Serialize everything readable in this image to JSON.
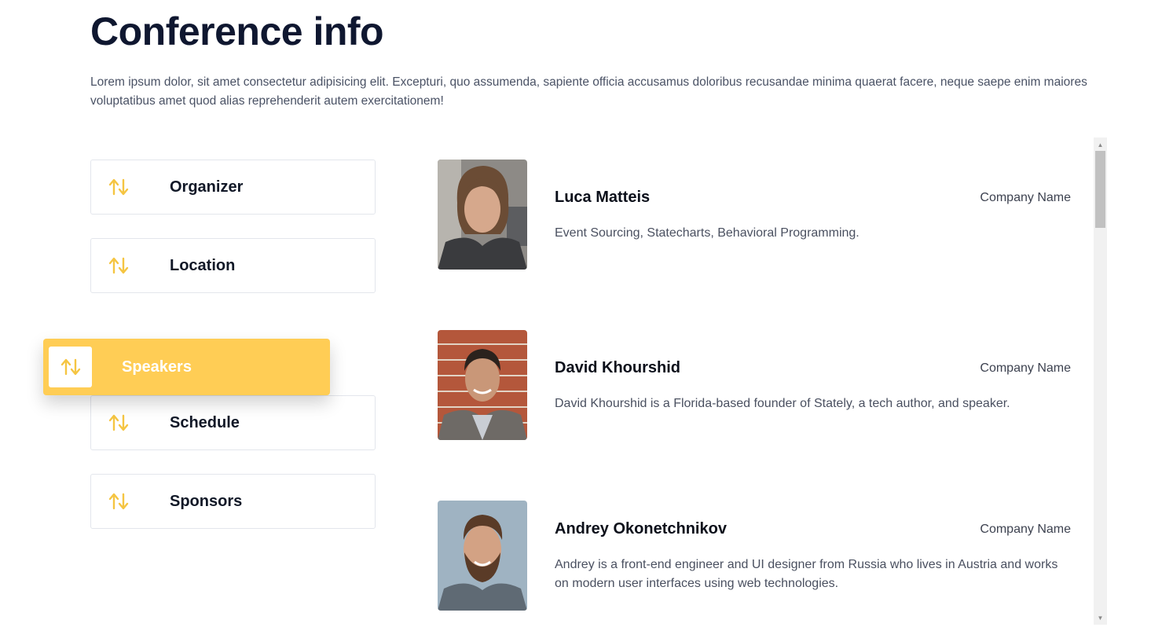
{
  "page": {
    "title": "Conference info",
    "intro": "Lorem ipsum dolor, sit amet consectetur adipisicing elit. Excepturi, quo assumenda, sapiente officia accusamus doloribus recusandae minima quaerat facere, neque saepe enim maiores voluptatibus amet quod alias reprehenderit autem exercitationem!"
  },
  "nav": {
    "icon": "sort-arrows-icon",
    "accent_color": "#ffcd55",
    "items": [
      {
        "label": "Organizer"
      },
      {
        "label": "Location"
      },
      {
        "label": "Schedule"
      },
      {
        "label": "Sponsors"
      }
    ],
    "dragging": {
      "label": "Speakers"
    }
  },
  "speakers": [
    {
      "name": "Luca Matteis",
      "company": "Company Name",
      "bio": "Event Sourcing, Statecharts, Behavioral Programming."
    },
    {
      "name": "David Khourshid",
      "company": "Company Name",
      "bio": "David Khourshid is a Florida-based founder of Stately, a tech author, and speaker."
    },
    {
      "name": "Andrey Okonetchnikov",
      "company": "Company Name",
      "bio": "Andrey is a front-end engineer and UI designer from Russia who lives in Austria and works on modern user interfaces using web technologies."
    }
  ]
}
